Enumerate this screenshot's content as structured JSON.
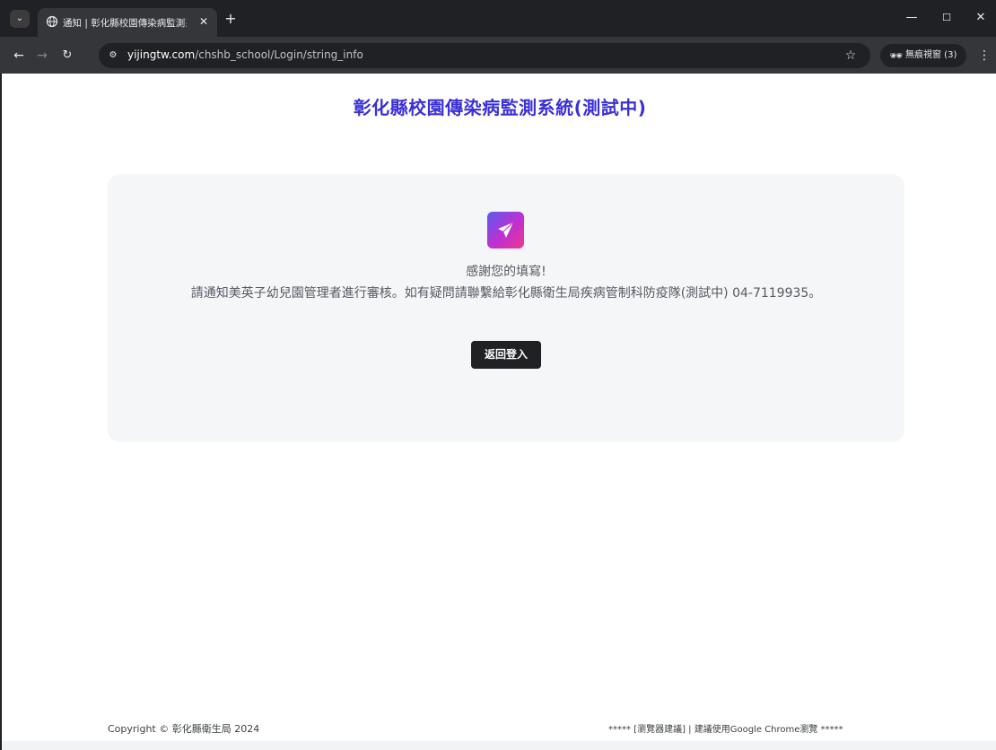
{
  "browser": {
    "tab_title": "通知 | 彰化縣校園傳染病監測系",
    "new_tab_symbol": "+",
    "close_symbol": "✕",
    "url_host": "yijingtw.com",
    "url_path": "/chshb_school/Login/string_info",
    "incognito_label": "無痕視窗 (3)",
    "window_controls": [
      "—",
      "☐",
      "✕"
    ]
  },
  "page": {
    "system_title": "彰化縣校園傳染病監測系統(測試中)",
    "thanks_text": "感謝您的填寫!",
    "notice_text": "請通知美英子幼兒園管理者進行審核。如有疑問請聯繫給彰化縣衛生局疾病管制科防疫隊(測試中) 04-7119935。",
    "back_button_label": "返回登入",
    "icon": "paper-plane-icon"
  },
  "footer": {
    "copyright": "Copyright © 彰化縣衛生局 2024",
    "browser_advice": "***** [瀏覽器建議] | 建議使用Google Chrome瀏覽 *****"
  },
  "colors": {
    "title": "#3a30d6",
    "button_bg": "#202124",
    "card_bg": "#f5f6f8"
  }
}
